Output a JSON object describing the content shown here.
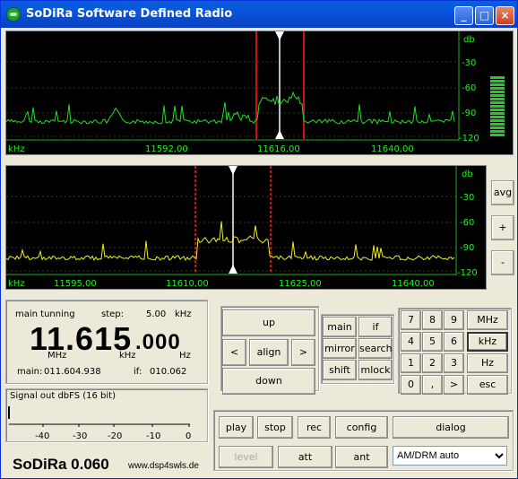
{
  "window": {
    "title": "SoDiRa Software Defined Radio"
  },
  "title_buttons": {
    "minimize": "_",
    "maximize": "□",
    "close": "×"
  },
  "spectrum1": {
    "db_unit": "db",
    "db_ticks": [
      "-30",
      "-60",
      "-90",
      "-120"
    ],
    "khz_label": "kHz",
    "freq_ticks": [
      "11592,00",
      "11616,00",
      "11640,00"
    ]
  },
  "spectrum2": {
    "db_unit": "db",
    "db_ticks": [
      "-30",
      "-60",
      "-90",
      "-120"
    ],
    "khz_label": "kHz",
    "freq_ticks": [
      "11595,00",
      "11610,00",
      "11625,00",
      "11640,00"
    ]
  },
  "side_buttons": {
    "avg": "avg",
    "plus": "+",
    "minus": "-"
  },
  "tuning": {
    "mode_label": "main tunning",
    "step_label": "step:",
    "step_value": "5.00",
    "step_unit": "kHz",
    "freq_main": "11.615",
    "freq_fine": ".000",
    "unit_mhz": "MHz",
    "unit_khz": "kHz",
    "unit_hz": "Hz",
    "main_label": "main:",
    "main_value": "011.604.938",
    "if_label": "if:",
    "if_value": "010.062"
  },
  "signal": {
    "title": "Signal out dbFS (16 bit)",
    "ticks": [
      "-40",
      "-30",
      "-20",
      "-10",
      "0"
    ]
  },
  "branding": {
    "name": "SoDiRa 0.060",
    "url": "www.dsp4swls.de"
  },
  "nav": {
    "up": "up",
    "left": "<",
    "align": "align",
    "right": ">",
    "down": "down"
  },
  "func": {
    "main": "main",
    "if": "if",
    "mirror": "mirror",
    "search": "search",
    "shift": "shift",
    "mlock": "mlock"
  },
  "keypad": {
    "keys": [
      "7",
      "8",
      "9",
      "4",
      "5",
      "6",
      "1",
      "2",
      "3",
      "0",
      ",",
      ">"
    ],
    "units": [
      "MHz",
      "kHz",
      "Hz",
      "esc"
    ]
  },
  "bottom": {
    "play": "play",
    "stop": "stop",
    "rec": "rec",
    "config": "config",
    "dialog": "dialog",
    "level": "level",
    "att": "att",
    "ant": "ant",
    "mode_selected": "AM/DRM auto"
  },
  "colors": {
    "spectrum1": "#22dd22",
    "spectrum2": "#f0f020",
    "marker": "#cc1111",
    "axis_text": "#22ee22",
    "smeter": "#22cc22"
  }
}
